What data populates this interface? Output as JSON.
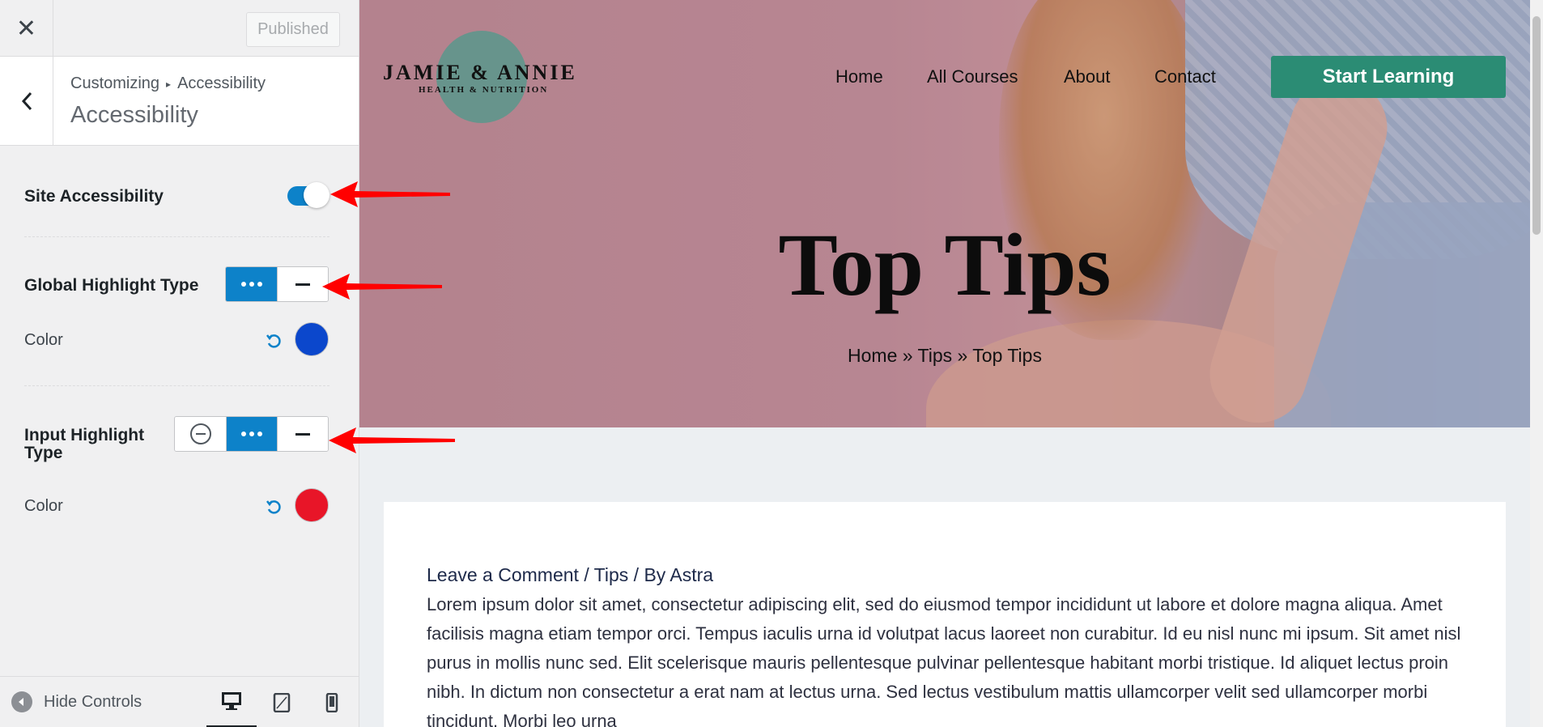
{
  "sidebar": {
    "published_label": "Published",
    "breadcrumb_root": "Customizing",
    "breadcrumb_current": "Accessibility",
    "section_title": "Accessibility",
    "site_accessibility": {
      "label": "Site Accessibility",
      "enabled": true
    },
    "global_highlight": {
      "label": "Global Highlight Type",
      "options": [
        "dotted-icon",
        "solid-icon"
      ],
      "selected": "dotted",
      "color_label": "Color",
      "color": "#0b47cc"
    },
    "input_highlight": {
      "label_line1": "Input Highlight",
      "label_line2": "Type",
      "options": [
        "disable-icon",
        "dotted-icon",
        "solid-icon"
      ],
      "selected": "dotted",
      "color_label": "Color",
      "color": "#e81528"
    },
    "footer": {
      "hide_controls": "Hide Controls",
      "devices": [
        "desktop-icon",
        "tablet-icon",
        "mobile-icon"
      ],
      "active_device": "desktop"
    }
  },
  "colors": {
    "accent": "#0d82c9",
    "annotation_arrow": "#ff0000",
    "cta": "#2b8c74"
  },
  "preview": {
    "logo_name": "JAMIE & ANNIE",
    "logo_tagline": "HEALTH & NUTRITION",
    "nav": [
      "Home",
      "All Courses",
      "About",
      "Contact"
    ],
    "cta_label": "Start Learning",
    "hero_title": "Top Tips",
    "hero_breadcrumb": "Home » Tips » Top Tips",
    "post_meta": "Leave a Comment / Tips / By Astra",
    "post_body": "Lorem ipsum dolor sit amet, consectetur adipiscing elit, sed do eiusmod tempor incididunt ut labore et dolore magna aliqua. Amet facilisis magna etiam tempor orci. Tempus iaculis urna id volutpat lacus laoreet non curabitur. Id eu nisl nunc mi ipsum. Sit amet nisl purus in mollis nunc sed. Elit scelerisque mauris pellentesque pulvinar pellentesque habitant morbi tristique. Id aliquet lectus proin nibh. In dictum non consectetur a erat nam at lectus urna. Sed lectus vestibulum mattis ullamcorper velit sed ullamcorper morbi tincidunt. Morbi leo urna"
  }
}
